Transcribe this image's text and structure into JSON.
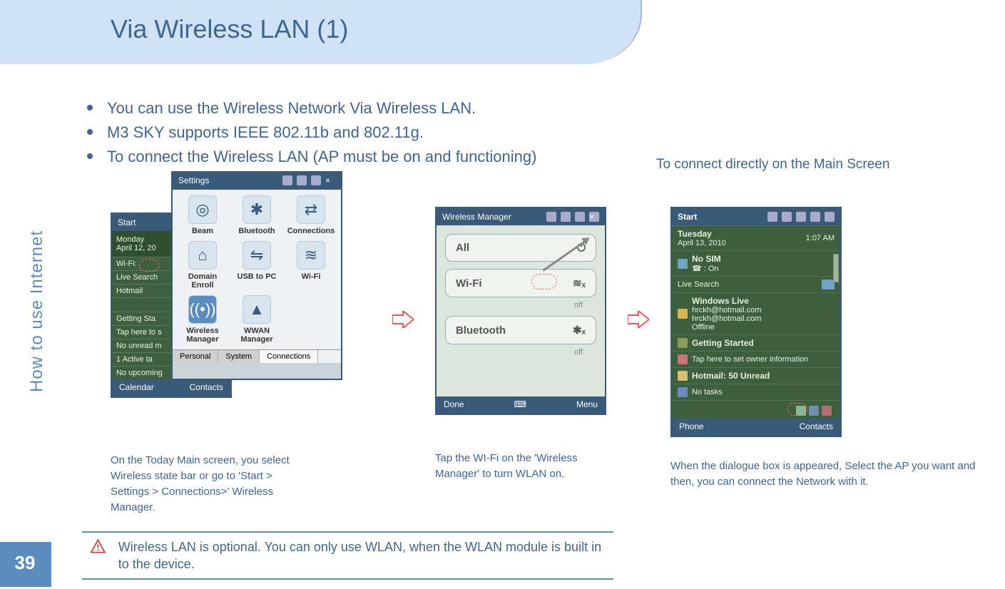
{
  "page_number": "39",
  "side_label": "How to use Internet",
  "title": "Via Wireless LAN (1)",
  "bullets": [
    "You can use the Wireless Network Via Wireless LAN.",
    "M3 SKY supports IEEE 802.11b and 802.11g.",
    "To connect the Wireless LAN (AP must be on and functioning)"
  ],
  "connect_note": "To connect directly on the Main Screen",
  "captions": {
    "c1": "On the Today Main screen, you select Wireless state bar or go to 'Start > Settings > Connections>' Wireless Manager.",
    "c2": "Tap the WI-Fi on the 'Wireless Manager' to turn WLAN on.",
    "c3": "When the dialogue box is appeared, Select the AP you want and then, you can connect the Network with it."
  },
  "warning": "Wireless LAN is optional. You can only use WLAN, when the WLAN module is built in to the device.",
  "settings_window": {
    "title": "Settings",
    "icons": [
      {
        "label": "Beam",
        "glyph": "◎"
      },
      {
        "label": "Bluetooth",
        "glyph": "✱"
      },
      {
        "label": "Connections",
        "glyph": "⇄"
      },
      {
        "label": "Domain Enroll",
        "glyph": "⌂"
      },
      {
        "label": "USB to PC",
        "glyph": "⇋"
      },
      {
        "label": "Wi-Fi",
        "glyph": "≋"
      },
      {
        "label": "Wireless Manager",
        "glyph": "((•))",
        "selected": true
      },
      {
        "label": "WWAN Manager",
        "glyph": "▲"
      }
    ],
    "tabs": [
      "Personal",
      "System",
      "Connections"
    ],
    "active_tab": "Connections"
  },
  "today_screen_left": {
    "header": "Start",
    "date": "Monday\nApril 12, 20",
    "items": [
      "Wi-Fi:",
      "Live Search",
      "Hotmail",
      "Getting Sta",
      "Tap here to s",
      "No unread m",
      "1 Active ta",
      "No upcoming"
    ],
    "footer_left": "Calendar",
    "footer_right": "Contacts"
  },
  "wireless_manager": {
    "title": "Wireless Manager",
    "all": "All",
    "wifi": "Wi-Fi",
    "wifi_state": "off",
    "bt": "Bluetooth",
    "bt_state": "off",
    "footer_left": "Done",
    "footer_right": "Menu"
  },
  "today_screen_right": {
    "header": "Start",
    "date_line1": "Tuesday",
    "date_line2": "April 13, 2010",
    "time": "1:07 AM",
    "sim": "No SIM",
    "sim_sub": "☎ : On",
    "search": "Live Search",
    "wl_header": "Windows Live",
    "wl_items": [
      "hrckh@hotmail.com",
      "hrckh@hotmail.com",
      "Offline"
    ],
    "gs": "Getting Started",
    "gs_sub": "Tap here to set owner information",
    "hotmail": "Hotmail: 50 Unread",
    "tasks": "No tasks",
    "footer_left": "Phone",
    "footer_right": "Contacts"
  }
}
